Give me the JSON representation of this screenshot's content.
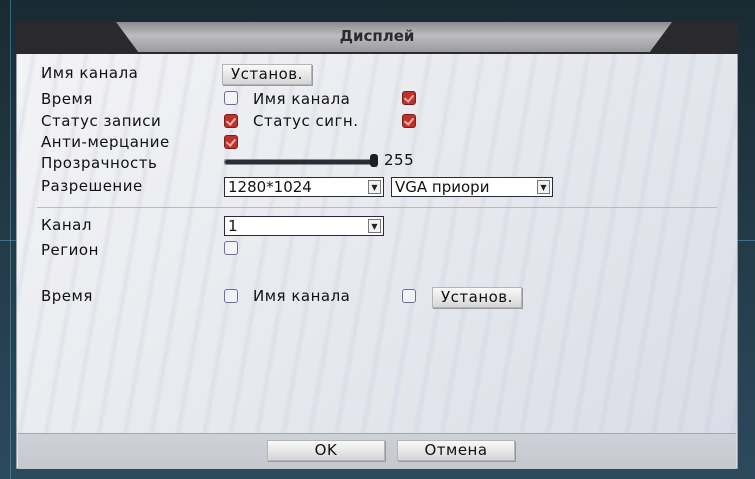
{
  "dialog": {
    "title": "Дисплей"
  },
  "labels": {
    "channel_name": "Имя канала",
    "time": "Время",
    "record_status": "Статус записи",
    "anti_flicker": "Анти-мерцание",
    "transparency": "Прозрачность",
    "resolution": "Разрешение",
    "channel": "Канал",
    "region": "Регион",
    "time2": "Время"
  },
  "controls": {
    "set_button": "Установ.",
    "channel_name_check_label": "Имя канала",
    "signal_status_label": "Статус сигн.",
    "transparency_value": "255",
    "transparency_level": 1.0,
    "resolution_value": "1280*1024",
    "vga_value": "VGA приори",
    "channel_value": "1",
    "channel_name_check_label2": "Имя канала",
    "set_button2": "Установ."
  },
  "checks": {
    "time": false,
    "channel_name": true,
    "record_status": true,
    "signal_status": true,
    "anti_flicker": true,
    "region": false,
    "time2": false,
    "channel_name2": false
  },
  "footer": {
    "ok": "OK",
    "cancel": "Отмена"
  },
  "colors": {
    "checked": "#c0312d",
    "accent": "#2c2c36"
  }
}
